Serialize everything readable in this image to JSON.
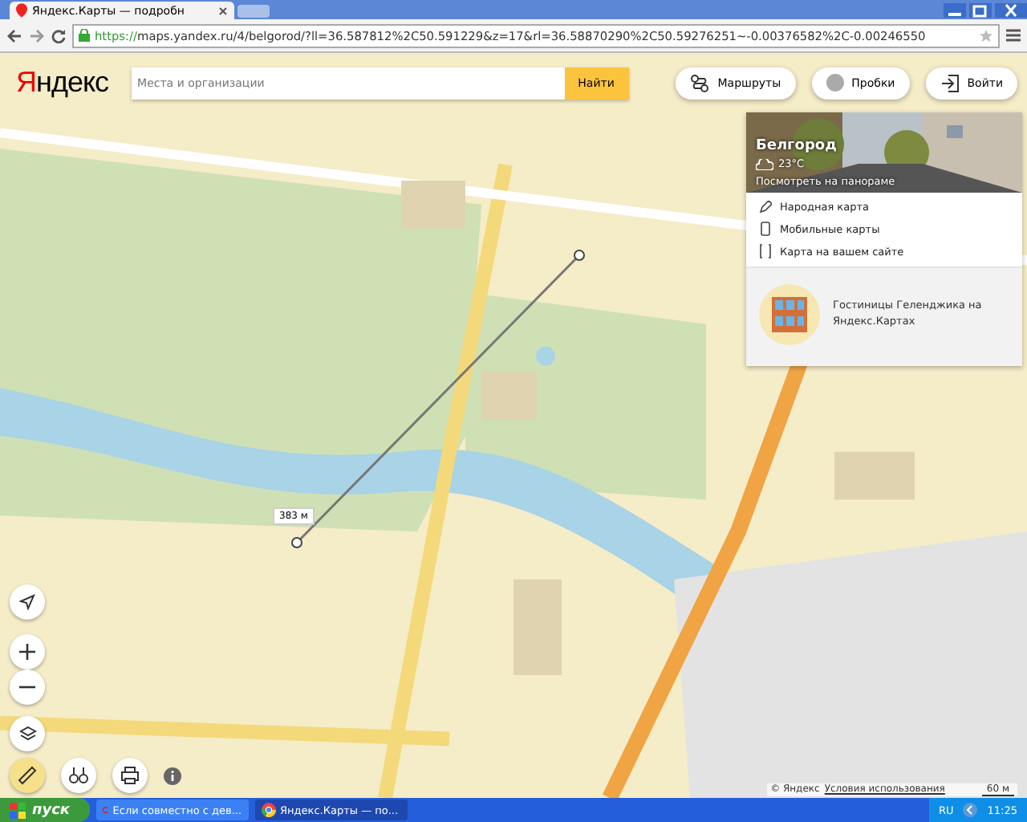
{
  "browser": {
    "tabs": [
      {
        "title": "Яндекс.Карты — подробн",
        "selected": true
      }
    ],
    "url_scheme": "https://",
    "url_rest": "maps.yandex.ru/4/belgorod/?ll=36.587812%2C50.591229&z=17&rl=36.58870290%2C50.59276251~-0.00376582%2C-0.00246550"
  },
  "logo": "Яндекс",
  "search": {
    "placeholder": "Места и организации",
    "button": "Найти"
  },
  "top_buttons": [
    {
      "label": "Маршруты",
      "kind": "routes"
    },
    {
      "label": "Пробки",
      "kind": "traffic"
    },
    {
      "label": "Войти",
      "kind": "login"
    }
  ],
  "panel": {
    "city": "Белгород",
    "weather": "23°C",
    "panorama_link": "Посмотреть на панораме",
    "links": [
      {
        "label": "Народная карта",
        "kind": "edit"
      },
      {
        "label": "Мобильные карты",
        "kind": "mobile"
      },
      {
        "label": "Карта на вашем сайте",
        "kind": "embed"
      }
    ],
    "promo": "Гостиницы Геленджика на Яндекс.Картах"
  },
  "ruler_label": "383 м",
  "footer": {
    "copyright": "© Яндекс",
    "terms": "Условия использования",
    "scale": "60 м"
  },
  "taskbar": {
    "start": "пуск",
    "tasks": [
      {
        "title": "Если совместно с дев...",
        "selected": false,
        "kind": "opera"
      },
      {
        "title": "Яндекс.Карты — по...",
        "selected": true,
        "kind": "chrome"
      }
    ],
    "lang": "RU",
    "time": "11:25"
  }
}
